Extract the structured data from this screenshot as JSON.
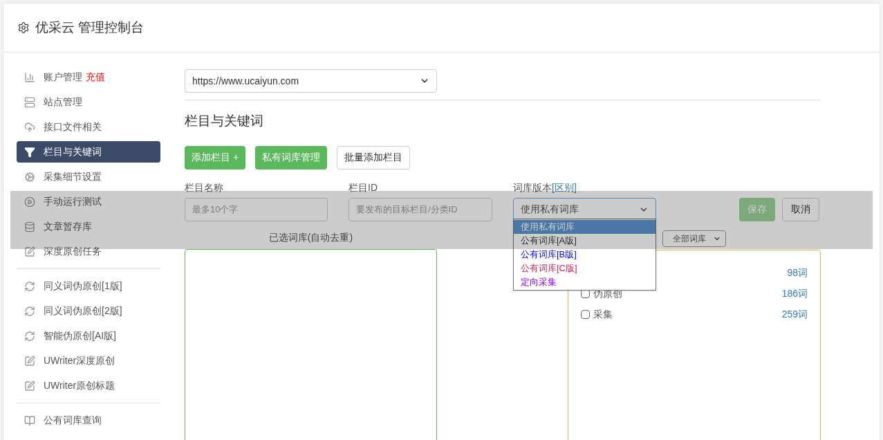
{
  "header": {
    "title": "优采云 管理控制台"
  },
  "sidebar": {
    "groups": [
      {
        "items": [
          {
            "label": "账户管理",
            "badge": "充值",
            "selected": false
          },
          {
            "label": "站点管理",
            "selected": false
          },
          {
            "label": "接口文件相关",
            "selected": false
          },
          {
            "label": "栏目与关键词",
            "selected": true
          },
          {
            "label": "采集细节设置",
            "selected": false
          },
          {
            "label": "手动运行测试",
            "selected": false
          },
          {
            "label": "文章暂存库",
            "selected": false
          },
          {
            "label": "深度原创任务",
            "selected": false
          }
        ]
      },
      {
        "items": [
          {
            "label": "同义词伪原创[1版]",
            "selected": false
          },
          {
            "label": "同义词伪原创[2版]",
            "selected": false
          },
          {
            "label": "智能伪原创[AI版]",
            "selected": false
          },
          {
            "label": "UWriter深度原创",
            "selected": false
          },
          {
            "label": "UWriter原创标题",
            "selected": false
          }
        ]
      },
      {
        "items": [
          {
            "label": "公有词库查询",
            "selected": false
          }
        ]
      }
    ]
  },
  "main": {
    "site_select": {
      "value": "https://www.ucaiyun.com"
    },
    "section_title": "栏目与关键词",
    "buttons": [
      {
        "label": "添加栏目 +",
        "kind": "primary"
      },
      {
        "label": "私有词库管理",
        "kind": "primary"
      },
      {
        "label": "批量添加栏目",
        "kind": "default"
      }
    ],
    "form": {
      "name_field": {
        "label": "栏目名称",
        "placeholder": "最多10个字"
      },
      "id_field": {
        "label": "栏目ID",
        "placeholder": "要发布的目标栏目/分类ID"
      },
      "version_field": {
        "label": "词库版本",
        "link": "[区别]",
        "value": "使用私有词库",
        "options": [
          {
            "label": "使用私有词库",
            "selected": true
          },
          {
            "label": "公有词库[A版]",
            "selected": false
          },
          {
            "label": "公有词库[B版]",
            "color": "#0000ff",
            "selected": false
          },
          {
            "label": "公有词库[C版]",
            "color": "#c7254e",
            "selected": false
          },
          {
            "label": "定向采集",
            "color": "#8a00ff",
            "selected": false
          }
        ]
      },
      "save": {
        "label": "保存",
        "disabled": true
      },
      "cancel": {
        "label": "取消"
      }
    },
    "selected_box": {
      "label": "已选词库(自动去重)"
    },
    "library_filter": {
      "value": "全部词库"
    },
    "library_rows": [
      {
        "count": "98词"
      },
      {
        "label": "伪原创",
        "checked": false,
        "count": "186词"
      },
      {
        "label": "采集",
        "checked": false,
        "count": "259词"
      }
    ]
  }
}
